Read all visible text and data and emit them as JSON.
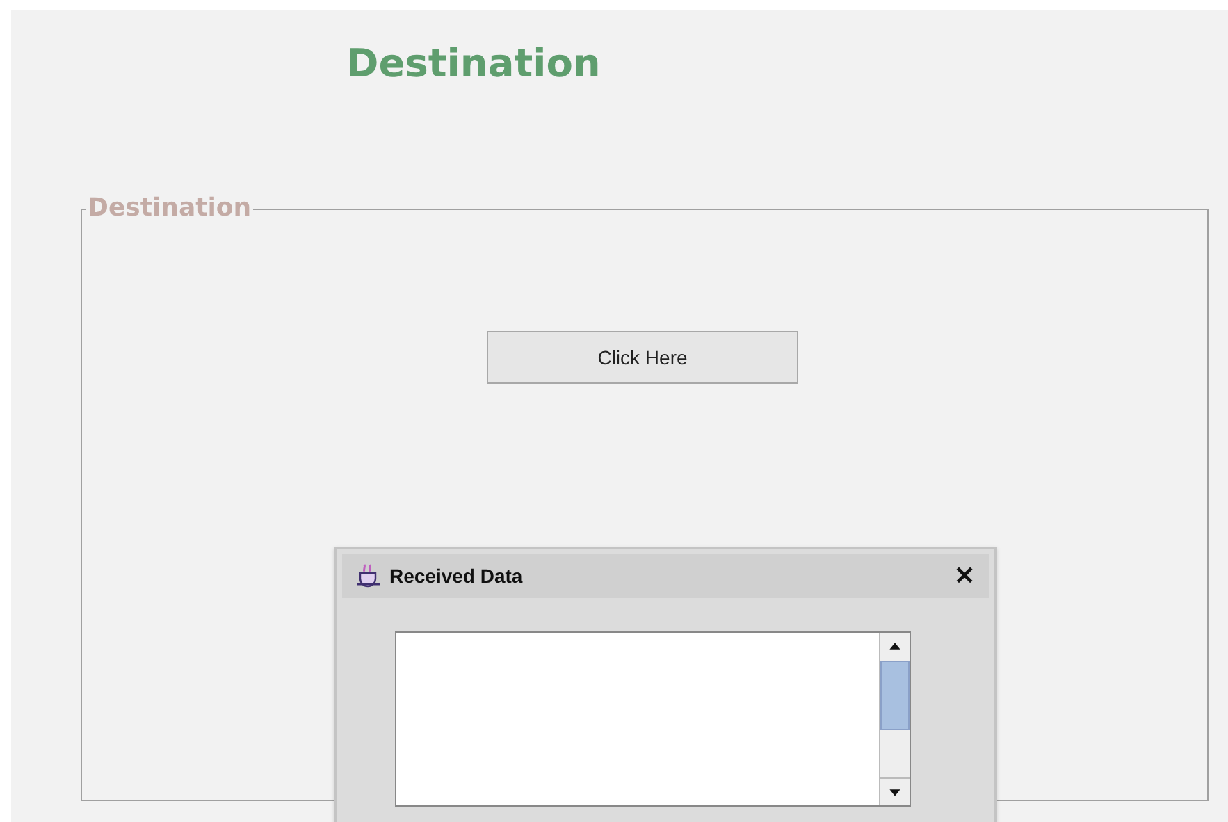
{
  "heading": "Destination",
  "group": {
    "legend": "Destination",
    "button": "Click Here"
  },
  "dialog": {
    "title": "Received Data",
    "close": "✕"
  }
}
